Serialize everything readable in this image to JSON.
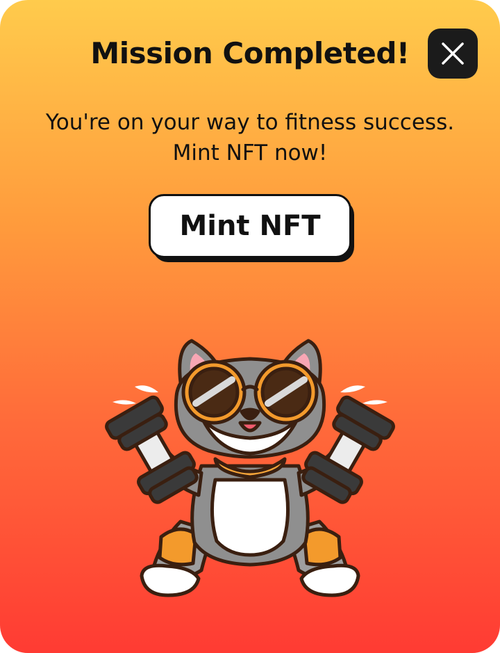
{
  "dialog": {
    "title": "Mission Completed!",
    "subtitle_line1": "You're on your way to fitness success.",
    "subtitle_line2": "Mint NFT now!",
    "mint_button_label": "Mint NFT",
    "close_icon": "close-icon",
    "mascot_icon": "cat-lifting-dumbbells-illustration"
  },
  "colors": {
    "gradient_top": "#FFCB4C",
    "gradient_bottom": "#FF3B33",
    "close_button_bg": "#1b1b1b",
    "button_bg": "#ffffff",
    "text": "#111111"
  }
}
